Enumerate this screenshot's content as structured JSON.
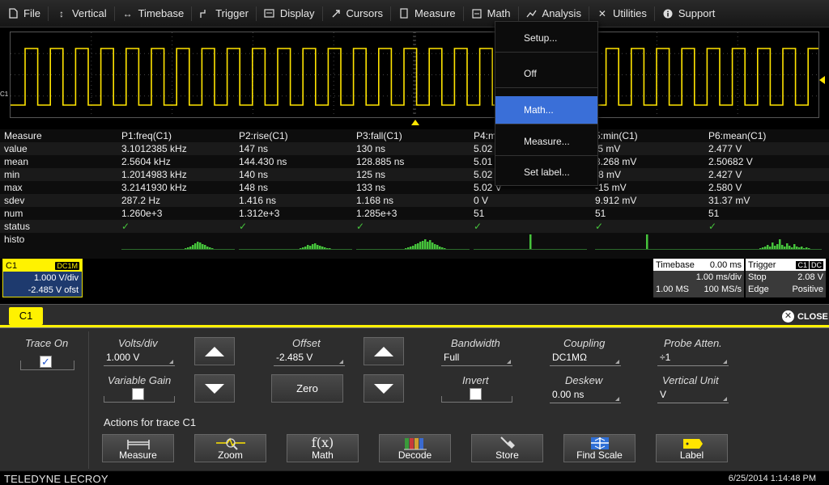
{
  "menu": {
    "items": [
      {
        "label": "File",
        "icon": "file-icon"
      },
      {
        "label": "Vertical",
        "icon": "vertical-arrows-icon"
      },
      {
        "label": "Timebase",
        "icon": "horizontal-arrows-icon"
      },
      {
        "label": "Trigger",
        "icon": "trigger-icon"
      },
      {
        "label": "Display",
        "icon": "display-icon"
      },
      {
        "label": "Cursors",
        "icon": "cursor-icon"
      },
      {
        "label": "Measure",
        "icon": "measure-icon"
      },
      {
        "label": "Math",
        "icon": "math-icon"
      },
      {
        "label": "Analysis",
        "icon": "analysis-icon"
      },
      {
        "label": "Utilities",
        "icon": "utilities-icon"
      },
      {
        "label": "Support",
        "icon": "info-icon"
      }
    ],
    "active": "Math"
  },
  "trace": {
    "channel_label": "C1",
    "color": "#ffe400"
  },
  "dropdown": {
    "items": [
      "Setup...",
      "Off",
      "Math...",
      "Measure...",
      "Set label..."
    ],
    "selected": "Math..."
  },
  "measure_table": {
    "header": [
      "Measure",
      "P1:freq(C1)",
      "P2:rise(C1)",
      "P3:fall(C1)",
      "P4:m",
      "5:min(C1)",
      "P6:mean(C1)"
    ],
    "rows": [
      {
        "label": "value",
        "cells": [
          "3.1012385 kHz",
          "147 ns",
          "130 ns",
          "5.02",
          ".5 mV",
          "2.477 V"
        ]
      },
      {
        "label": "mean",
        "cells": [
          "2.5604 kHz",
          "144.430 ns",
          "128.885 ns",
          "5.01",
          "8.268 mV",
          "2.50682 V"
        ]
      },
      {
        "label": "min",
        "cells": [
          "1.2014983 kHz",
          "140 ns",
          "125 ns",
          "5.02",
          "-8 mV",
          "2.427 V"
        ]
      },
      {
        "label": "max",
        "cells": [
          "3.2141930 kHz",
          "148 ns",
          "133 ns",
          "5.02 V",
          "-15 mV",
          "2.580 V"
        ]
      },
      {
        "label": "sdev",
        "cells": [
          "287.2 Hz",
          "1.416 ns",
          "1.168 ns",
          "0 V",
          "9.912 mV",
          "31.37 mV"
        ]
      },
      {
        "label": "num",
        "cells": [
          "1.260e+3",
          "1.312e+3",
          "1.285e+3",
          "51",
          "51",
          "51"
        ]
      },
      {
        "label": "status",
        "cells": [
          "✓",
          "✓",
          "✓",
          "✓",
          "✓",
          "✓"
        ]
      },
      {
        "label": "histo",
        "cells": [
          "",
          "",
          "",
          "",
          "",
          ""
        ]
      }
    ],
    "check_color": "#46c43c",
    "histo_color": "#46c43c"
  },
  "channel_box": {
    "name": "C1",
    "coupling": "DC1M",
    "vdiv": "1.000 V/div",
    "offset": "-2.485 V ofst"
  },
  "timebase_box": {
    "title": "Timebase",
    "delay": "0.00 ms",
    "tdiv": "1.00 ms/div",
    "samples": "1.00 MS",
    "rate": "100 MS/s"
  },
  "trigger_box": {
    "title": "Trigger",
    "tag1": "C1",
    "tag2": "DC",
    "mode": "Stop",
    "level": "2.08 V",
    "type": "Edge",
    "slope": "Positive"
  },
  "dialog": {
    "tab": "C1",
    "close_label": "CLOSE",
    "trace_on_label": "Trace On",
    "trace_on": true,
    "volts_div_label": "Volts/div",
    "volts_div_value": "1.000 V",
    "variable_gain_label": "Variable Gain",
    "offset_label": "Offset",
    "offset_value": "-2.485 V",
    "zero_label": "Zero",
    "bandwidth_label": "Bandwidth",
    "bandwidth_value": "Full",
    "invert_label": "Invert",
    "coupling_label": "Coupling",
    "coupling_value": "DC1MΩ",
    "deskew_label": "Deskew",
    "deskew_value": "0.00 ns",
    "probe_atten_label": "Probe Atten.",
    "probe_atten_value": "÷1",
    "vertical_unit_label": "Vertical Unit",
    "vertical_unit_value": "V",
    "actions_title": "Actions for trace C1",
    "actions": [
      {
        "label": "Measure",
        "icon": "measure-caliper-icon"
      },
      {
        "label": "Zoom",
        "icon": "zoom-icon"
      },
      {
        "label": "Math",
        "icon": "fx-icon"
      },
      {
        "label": "Decode",
        "icon": "decode-icon"
      },
      {
        "label": "Store",
        "icon": "store-icon"
      },
      {
        "label": "Find Scale",
        "icon": "find-scale-icon"
      },
      {
        "label": "Label",
        "icon": "label-tag-icon"
      }
    ]
  },
  "status": {
    "brand": "TELEDYNE LECROY",
    "datetime": "6/25/2014 1:14:48 PM"
  }
}
